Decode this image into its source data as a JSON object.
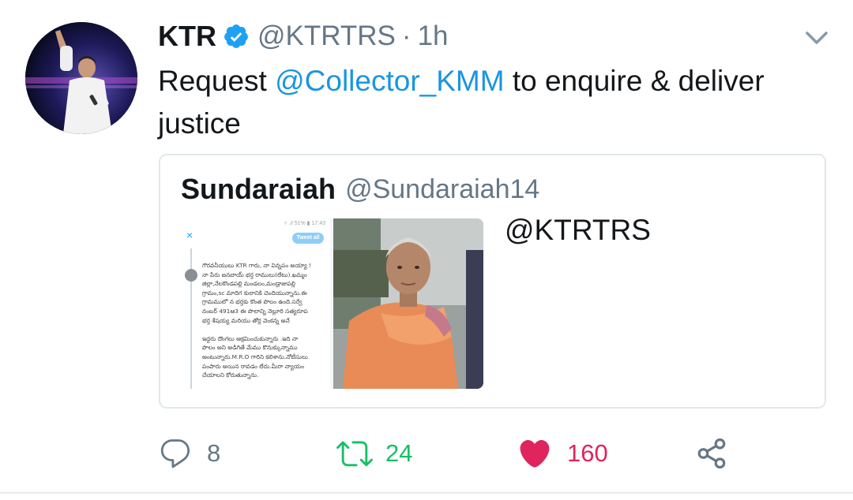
{
  "author": {
    "name": "KTR",
    "handle": "@KTRTRS",
    "separator": "·",
    "time": "1h"
  },
  "tweet": {
    "text_before": "Request ",
    "mention": "@Collector_KMM",
    "text_after": " to enquire & deliver justice"
  },
  "quoted": {
    "name": "Sundaraiah",
    "handle": "@Sundaraiah14",
    "text": "@KTRTRS",
    "screenshot": {
      "status": "▿ .ıl 51% ▮ 17:43",
      "button": "Tweet all",
      "close": "×",
      "lines": [
        "గౌరవనీయులు KTR గారు, నా విన్నపం అయ్యా !",
        "నా పేరు జనబాయ్ భర్త రాములు(లేటు).ఖమ్మం",
        "జిల్లా,నేలకొండపల్లి మండలం,మండ్రాజుపల్లి",
        "గ్రామం,sc మాదిగ కులానికి చెందియున్నాను.ఈ",
        "గ్రామములో న భర్తకు కొంత పొలం ఉంది.సర్వే",
        "నంబర్ 491ఆ3 ఈ పొలాన్ని నెల్లూరి సత్యరూప",
        "భర్త శేషయ్య మరియు తోర్ల వెంకన్న అనే",
        "",
        "ఇద్దరు దొంగలు ఆక్రమించుకున్నారు .ఇది నా",
        "పొలం అని అడిగితే మేము కొనుక్కున్నాము",
        "అంటున్నారు.M.R.O గారిని కలిశాను.నోటీసులు",
        "పంపారు అయిన రావడం లేదు.మీరా న్యాయం",
        "చేయాలని కోరుతున్నాను."
      ]
    }
  },
  "actions": {
    "replies": "8",
    "retweets": "24",
    "likes": "160"
  },
  "colors": {
    "text": "#14171a",
    "muted": "#657786",
    "link": "#1b95e0",
    "verified": "#1da1f2",
    "retweet": "#17bf63",
    "like": "#e0245e",
    "border": "#e1e8ed"
  }
}
